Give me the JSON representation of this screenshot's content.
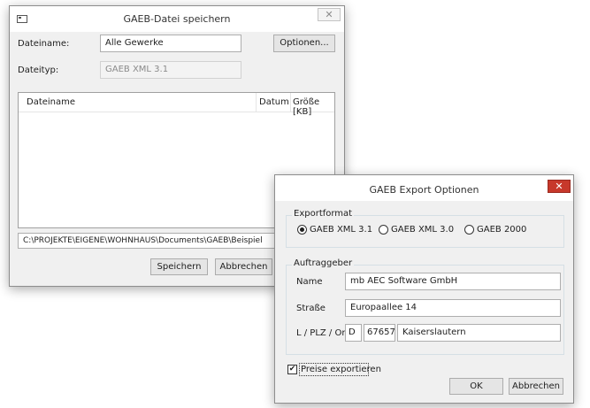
{
  "save_dialog": {
    "title": "GAEB-Datei speichern",
    "close_glyph": "✕",
    "filename_label": "Dateiname:",
    "filename_value": "Alle Gewerke",
    "options_button": "Optionen...",
    "filetype_label": "Dateityp:",
    "filetype_value": "GAEB XML 3.1",
    "list_columns": [
      "Dateiname",
      "Datum",
      "Größe [KB]"
    ],
    "path": "C:\\PROJEKTE\\EIGENE\\WOHNHAUS\\Documents\\GAEB\\Beispiel",
    "save_button": "Speichern",
    "cancel_button": "Abbrechen"
  },
  "export_dialog": {
    "title": "GAEB Export Optionen",
    "close_glyph": "✕",
    "format_group": "Exportformat",
    "formats": [
      {
        "label": "GAEB XML 3.1",
        "selected": true
      },
      {
        "label": "GAEB XML 3.0",
        "selected": false
      },
      {
        "label": "GAEB 2000",
        "selected": false
      }
    ],
    "client_group": "Auftraggeber",
    "name_label": "Name",
    "name_value": "mb AEC Software GmbH",
    "street_label": "Straße",
    "street_value": "Europaallee 14",
    "location_label": "L / PLZ / Ort",
    "country_value": "D",
    "zip_value": "67657",
    "city_value": "Kaiserslautern",
    "export_prices_label": "Preise exportieren",
    "export_prices_checked": true,
    "check_glyph": "✔",
    "ok_button": "OK",
    "cancel_button": "Abbrechen"
  }
}
